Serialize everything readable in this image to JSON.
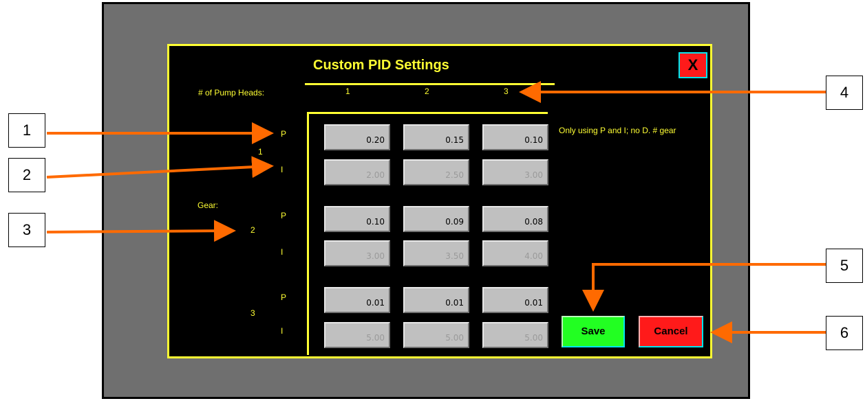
{
  "dialog": {
    "title": "Custom PID Settings",
    "close_label": "X",
    "pump_heads_label": "# of Pump Heads:",
    "pump_head_columns": [
      "1",
      "2",
      "3"
    ],
    "gear_label": "Gear:",
    "note": "Only using P and I; no D. # gear",
    "groups": [
      {
        "gear": "1",
        "p_label": "P",
        "i_label": "I",
        "p_values": [
          "0.20",
          "0.15",
          "0.10"
        ],
        "i_values": [
          "2.00",
          "2.50",
          "3.00"
        ]
      },
      {
        "gear": "2",
        "p_label": "P",
        "i_label": "I",
        "p_values": [
          "0.10",
          "0.09",
          "0.08"
        ],
        "i_values": [
          "3.00",
          "3.50",
          "4.00"
        ]
      },
      {
        "gear": "3",
        "p_label": "P",
        "i_label": "I",
        "p_values": [
          "0.01",
          "0.01",
          "0.01"
        ],
        "i_values": [
          "5.00",
          "5.00",
          "5.00"
        ]
      }
    ],
    "save_label": "Save",
    "cancel_label": "Cancel"
  },
  "callouts": [
    "1",
    "2",
    "3",
    "4",
    "5",
    "6"
  ],
  "colors": {
    "accent": "#ffff33",
    "arrow": "#ff6a00",
    "save": "#22ff22",
    "cancel": "#ff1a1a",
    "cell": "#c0c0c0"
  }
}
